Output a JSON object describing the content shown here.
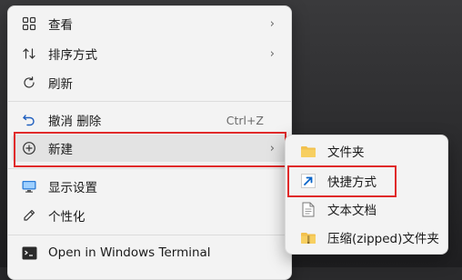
{
  "context_menu": {
    "items": [
      {
        "label": "查看",
        "icon": "grid-view-icon",
        "submenu": true
      },
      {
        "label": "排序方式",
        "icon": "sort-icon",
        "submenu": true
      },
      {
        "label": "刷新",
        "icon": "refresh-icon"
      },
      {
        "label": "撤消 删除",
        "icon": "undo-icon",
        "accelerator": "Ctrl+Z"
      },
      {
        "label": "新建",
        "icon": "add-circle-icon",
        "submenu": true
      },
      {
        "label": "显示设置",
        "icon": "display-settings-icon"
      },
      {
        "label": "个性化",
        "icon": "personalize-pen-icon"
      },
      {
        "label": "Open in Windows Terminal",
        "icon": "terminal-icon"
      }
    ],
    "chevron": "›"
  },
  "new_submenu": {
    "items": [
      {
        "label": "文件夹",
        "icon": "folder-icon"
      },
      {
        "label": "快捷方式",
        "icon": "shortcut-arrow-icon"
      },
      {
        "label": "文本文档",
        "icon": "text-document-icon"
      },
      {
        "label": "压缩(zipped)文件夹",
        "icon": "zip-folder-icon"
      }
    ]
  },
  "colors": {
    "highlight": "#e02a2a",
    "menu_bg": "#f3f3f3",
    "accent": "#0a64c8"
  }
}
